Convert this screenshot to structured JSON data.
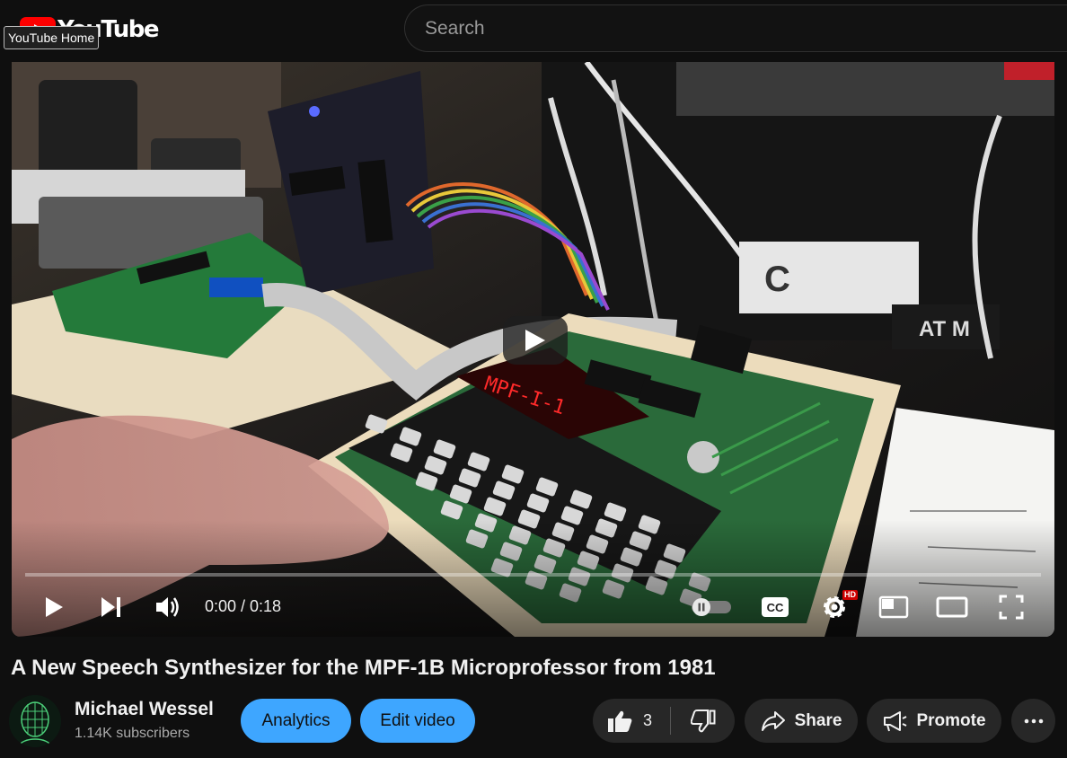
{
  "header": {
    "logo_text": "YouTube",
    "tooltip": "YouTube Home",
    "search_placeholder": "Search"
  },
  "player": {
    "current_time": "0:00",
    "duration": "0:18",
    "time_display": "0:00 / 0:18",
    "progress_fraction": 0,
    "hd_badge": "HD",
    "icons": [
      "play-icon",
      "next-icon",
      "volume-icon",
      "autoplay-toggle",
      "captions-icon",
      "settings-icon",
      "miniplayer-icon",
      "theater-icon",
      "fullscreen-icon"
    ]
  },
  "video": {
    "title": "A New Speech Synthesizer for the MPF-1B Microprofessor from 1981"
  },
  "channel": {
    "name": "Michael Wessel",
    "subscribers": "1.14K subscribers"
  },
  "actions": {
    "analytics": "Analytics",
    "edit_video": "Edit video",
    "like_count": "3",
    "share": "Share",
    "promote": "Promote"
  },
  "colors": {
    "background": "#0f0f0f",
    "accent_blue": "#3ea6ff",
    "chip": "#272727",
    "brand_red": "#ff0000"
  }
}
